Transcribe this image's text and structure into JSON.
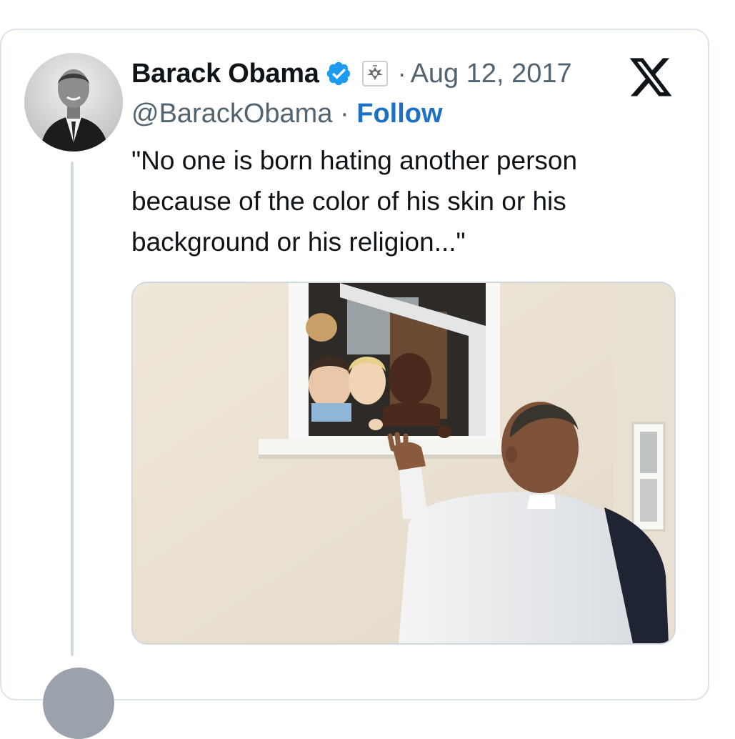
{
  "tweet": {
    "author_name": "Barack Obama",
    "handle": "@BarackObama",
    "separator": "·",
    "follow_label": "Follow",
    "date": "Aug 12, 2017",
    "text": "\"No one is born hating another person because of the color of his skin or his background or his religion...\""
  },
  "icons": {
    "verified": "verified-badge-icon",
    "government": "government-seal-icon",
    "platform": "x-logo-icon"
  },
  "colors": {
    "verified_blue": "#1d9bf0",
    "follow_blue": "#1d71c5",
    "secondary_text": "#536471",
    "border": "#dde3e8"
  }
}
